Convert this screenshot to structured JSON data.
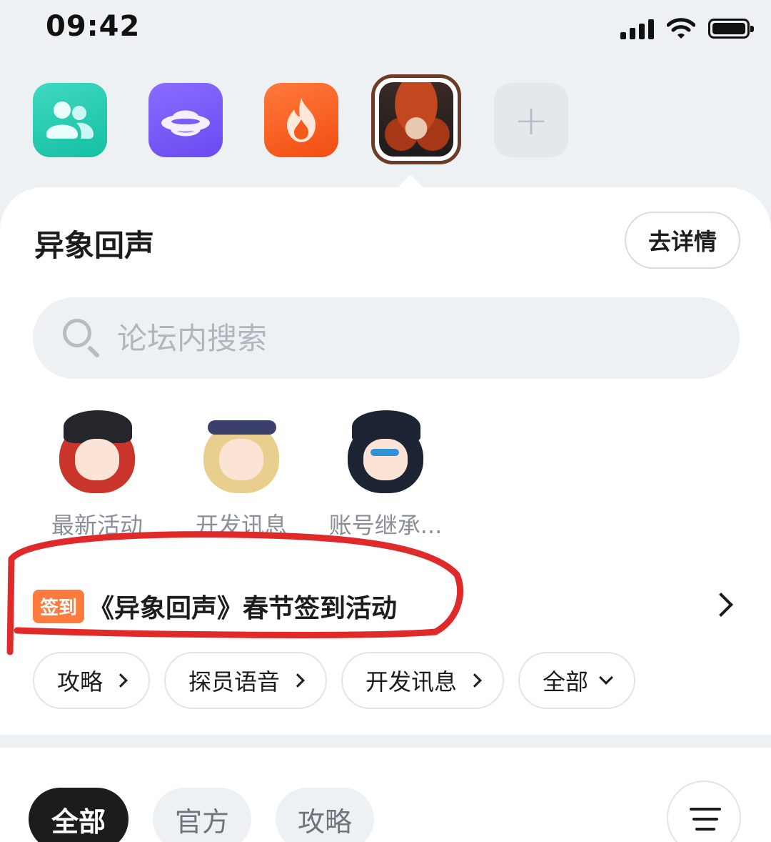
{
  "status_bar": {
    "time": "09:42"
  },
  "app_row": {
    "icons": [
      "people-icon",
      "planet-icon",
      "flame-icon",
      "game-avatar",
      "plus-icon"
    ],
    "add_label": "+"
  },
  "forum": {
    "title": "异象回声",
    "details_label": "去详情",
    "search_placeholder": "论坛内搜索"
  },
  "quick_entries": [
    {
      "label": "最新活动"
    },
    {
      "label": "开发讯息"
    },
    {
      "label": "账号继承..."
    }
  ],
  "signin": {
    "badge": "签到",
    "title": "《异象回声》春节签到活动",
    "highlight_color": "#e02a2a"
  },
  "chips": [
    {
      "label": "攻略"
    },
    {
      "label": "探员语音"
    },
    {
      "label": "开发讯息"
    },
    {
      "label": "全部"
    }
  ],
  "filter_tabs": [
    {
      "label": "全部",
      "selected": true
    },
    {
      "label": "官方",
      "selected": false
    },
    {
      "label": "攻略",
      "selected": false
    }
  ],
  "colors": {
    "accent": "#ff7b3d",
    "selected_tab": "#1b1c1e",
    "page_bg": "#eef1f4"
  }
}
